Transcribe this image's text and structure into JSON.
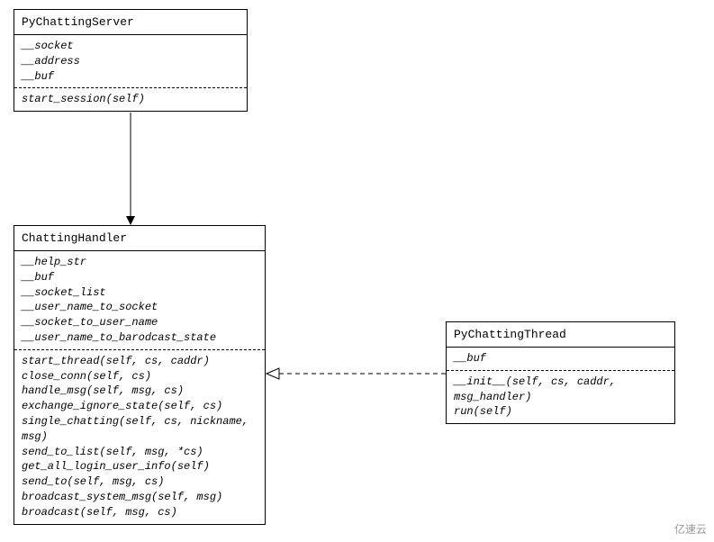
{
  "classes": {
    "pyChattingServer": {
      "name": "PyChattingServer",
      "attrs": [
        "__socket",
        "__address",
        "__buf"
      ],
      "methods": [
        "start_session(self)"
      ]
    },
    "chattingHandler": {
      "name": "ChattingHandler",
      "attrs": [
        "__help_str",
        "__buf",
        "__socket_list",
        "__user_name_to_socket",
        "__socket_to_user_name",
        "__user_name_to_barodcast_state"
      ],
      "methods": [
        "start_thread(self, cs, caddr)",
        "close_conn(self, cs)",
        "handle_msg(self, msg, cs)",
        "exchange_ignore_state(self, cs)",
        "single_chatting(self, cs, nickname, msg)",
        "send_to_list(self, msg, *cs)",
        "get_all_login_user_info(self)",
        "send_to(self, msg, cs)",
        "broadcast_system_msg(self, msg)",
        "broadcast(self, msg, cs)"
      ]
    },
    "pyChattingThread": {
      "name": "PyChattingThread",
      "attrs": [
        "__buf"
      ],
      "methods": [
        "__init__(self, cs, caddr, msg_handler)",
        "run(self)"
      ]
    }
  },
  "watermark": "亿速云"
}
